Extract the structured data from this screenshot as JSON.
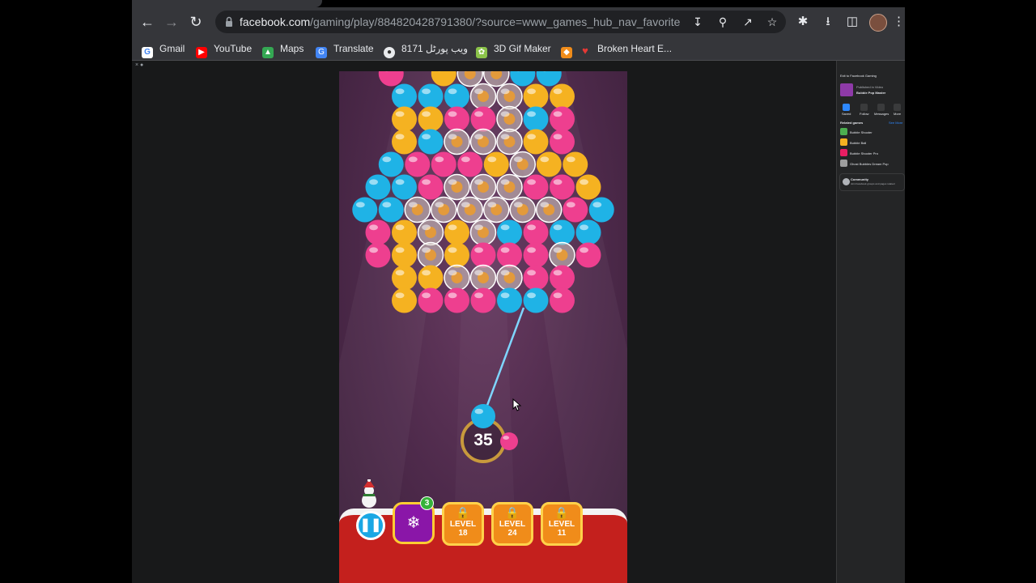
{
  "browser": {
    "url_domain": "facebook.com",
    "url_path": "/gaming/play/884820428791380/?source=www_games_hub_nav_favorite",
    "back_icon": "arrow-left-icon",
    "forward_icon": "arrow-right-icon",
    "reload_icon": "reload-icon"
  },
  "bookmarks": [
    {
      "label": "Gmail",
      "icon": "google-icon",
      "color": "#ffffff"
    },
    {
      "label": "YouTube",
      "icon": "youtube-icon",
      "color": "#ff0000"
    },
    {
      "label": "Maps",
      "icon": "maps-icon",
      "color": "#34a853"
    },
    {
      "label": "Translate",
      "icon": "translate-icon",
      "color": "#4285f4"
    },
    {
      "label": "8171 ویب پورٹل",
      "icon": "globe-icon",
      "color": "#e8eaed"
    },
    {
      "label": "3D Gif Maker",
      "icon": "gif-maker-icon",
      "color": "#8bc34a"
    },
    {
      "label": "",
      "icon": "shield-icon",
      "color": "#f08c1a"
    },
    {
      "label": "Broken Heart E...",
      "icon": "heart-icon",
      "color": "#e53935"
    }
  ],
  "game": {
    "shots_left": "35",
    "booster_count": "3",
    "levels": [
      {
        "word": "LEVEL",
        "num": "18"
      },
      {
        "word": "LEVEL",
        "num": "24"
      },
      {
        "word": "LEVEL",
        "num": "11"
      }
    ],
    "colors": {
      "blue": "#1fb3e6",
      "yellow": "#f5b221",
      "pink": "#ee3f8f",
      "clear": "#d9cfc6"
    }
  },
  "sidebar": {
    "link": "Exit to Facebook Gaming",
    "game_title": "Bubble Pop Master",
    "game_sub": "Published in Video",
    "actions": [
      "Saved",
      "Follow",
      "Messages",
      "More"
    ],
    "related_header": "Related games",
    "see_all": "See More",
    "related": [
      "Bubble Shooter",
      "Bubble Ball",
      "Bubble Shooter Pro",
      "Ghost Bubbles Dream Pop"
    ],
    "community": "Community",
    "community_sub": "Join Facebook groups and pages related"
  }
}
